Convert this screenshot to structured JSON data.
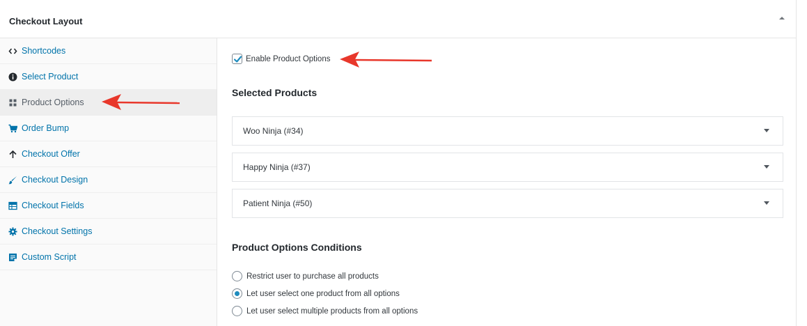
{
  "panel": {
    "title": "Checkout Layout",
    "toggle_icon": "caret-up-icon"
  },
  "sidebar": {
    "items": [
      {
        "label": "Shortcodes",
        "icon": "code-icon"
      },
      {
        "label": "Select Product",
        "icon": "info-icon"
      },
      {
        "label": "Product Options",
        "icon": "grid-icon"
      },
      {
        "label": "Order Bump",
        "icon": "cart-icon"
      },
      {
        "label": "Checkout Offer",
        "icon": "arrow-up-icon"
      },
      {
        "label": "Checkout Design",
        "icon": "brush-icon"
      },
      {
        "label": "Checkout Fields",
        "icon": "table-icon"
      },
      {
        "label": "Checkout Settings",
        "icon": "gear-icon"
      },
      {
        "label": "Custom Script",
        "icon": "script-icon"
      }
    ],
    "active": "Product Options"
  },
  "content": {
    "enable_label": "Enable Product Options",
    "enable_checked": true,
    "selected_products_title": "Selected Products",
    "products": [
      {
        "name": "Woo Ninja (#34)"
      },
      {
        "name": "Happy Ninja (#37)"
      },
      {
        "name": "Patient Ninja (#50)"
      }
    ],
    "conditions_title": "Product Options Conditions",
    "conditions": [
      {
        "label": "Restrict user to purchase all products",
        "checked": false
      },
      {
        "label": "Let user select one product from all options",
        "checked": true
      },
      {
        "label": "Let user select multiple products from all options",
        "checked": false
      }
    ]
  },
  "colors": {
    "link": "#0073aa",
    "annotation_arrow": "#e8372b",
    "radio_selected": "#1e8cbe",
    "active_nav_bg": "#eeeeee"
  }
}
